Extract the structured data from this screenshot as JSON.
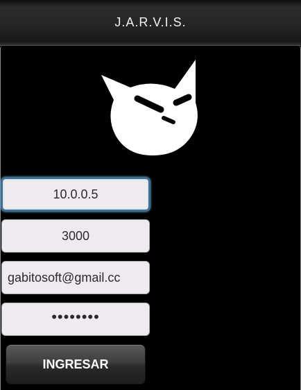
{
  "app": {
    "title": "J.A.R.V.I.S."
  },
  "logo": {
    "icon": "cat-face-icon"
  },
  "form": {
    "ip_value": "10.0.0.5",
    "port_value": "3000",
    "email_value": "gabitosoft@gmail.cc",
    "password_masked": "••••••••",
    "submit_label": "INGRESAR"
  },
  "colors": {
    "background": "#000000",
    "field_background": "#eeebef",
    "focus_ring": "#6fb6e8",
    "text_light": "#f2f2f2"
  }
}
